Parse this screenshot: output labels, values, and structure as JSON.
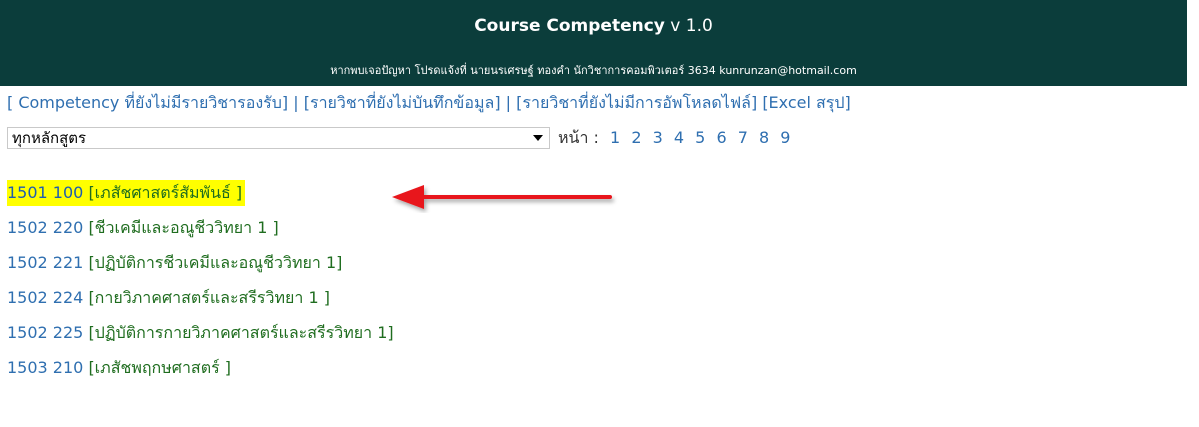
{
  "header": {
    "title": "Course Competency",
    "version": "v 1.0",
    "contact": "หากพบเจอปัญหา โปรดแจ้งที่ นายนรเศรษฐ์ ทองคำ นักวิชาการคอมพิวเตอร์ 3634 kunrunzan@hotmail.com"
  },
  "nav": {
    "link1": "[ Competency ที่ยังไม่มีรายวิชารองรับ]",
    "link2": "[รายวิชาที่ยังไม่บันทึกข้อมูล]",
    "link3": "[รายวิชาที่ยังไม่มีการอัพโหลดไฟล์]",
    "link4": "[Excel สรุป]",
    "sep": "|"
  },
  "filter": {
    "selected": "ทุกหลักสูตร",
    "page_label": "หน้า :",
    "pages": [
      "1",
      "2",
      "3",
      "4",
      "5",
      "6",
      "7",
      "8",
      "9"
    ]
  },
  "courses": [
    {
      "code": "1501 100",
      "name": "[เภสัชศาสตร์สัมพันธ์ ]"
    },
    {
      "code": "1502 220",
      "name": "[ชีวเคมีและอณูชีววิทยา 1 ]"
    },
    {
      "code": "1502 221",
      "name": "[ปฏิบัติการชีวเคมีและอณูชีววิทยา 1]"
    },
    {
      "code": "1502 224",
      "name": "[กายวิภาคศาสตร์และสรีรวิทยา 1 ]"
    },
    {
      "code": "1502 225",
      "name": "[ปฏิบัติการกายวิภาคศาสตร์และสรีรวิทยา 1]"
    },
    {
      "code": "1503 210",
      "name": "[เภสัชพฤกษศาสตร์ ]"
    }
  ],
  "colors": {
    "header_bg": "#0b3d3b",
    "link": "#2f6fb0",
    "course_name": "#1f6d1f",
    "highlight": "#ffff00",
    "annotation_arrow": "#e8141b"
  }
}
